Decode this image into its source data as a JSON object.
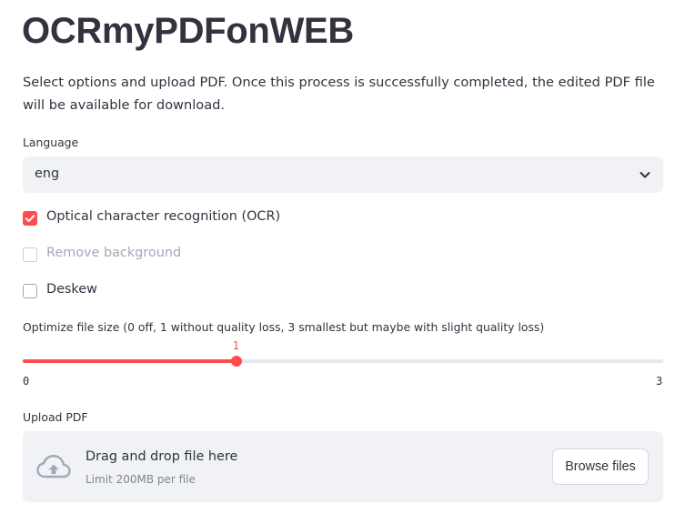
{
  "app": {
    "title": "OCRmyPDFonWEB",
    "intro": "Select options and upload PDF. Once this process is successfully completed, the edited PDF file will be available for download."
  },
  "language": {
    "label": "Language",
    "selected": "eng",
    "icon": "chevron-down-icon"
  },
  "options": {
    "ocr": {
      "label": "Optical character recognition (OCR)",
      "checked": true,
      "disabled": false
    },
    "remove_background": {
      "label": "Remove background",
      "checked": false,
      "disabled": true
    },
    "deskew": {
      "label": "Deskew",
      "checked": false,
      "disabled": false
    }
  },
  "optimize": {
    "label": "Optimize file size (0 off, 1 without quality loss, 3 smallest but maybe with slight quality loss)",
    "value": 1,
    "value_label": "1",
    "min": 0,
    "max": 3,
    "min_label": "0",
    "max_label": "3"
  },
  "upload": {
    "label": "Upload PDF",
    "drop_text": "Drag and drop file here",
    "limit_text": "Limit 200MB per file",
    "browse_label": "Browse files",
    "icon": "cloud-upload-icon"
  },
  "colors": {
    "accent": "#ff4b4b",
    "text": "#31333f",
    "widget_bg": "#f0f2f6",
    "muted": "#a3a8b8"
  }
}
